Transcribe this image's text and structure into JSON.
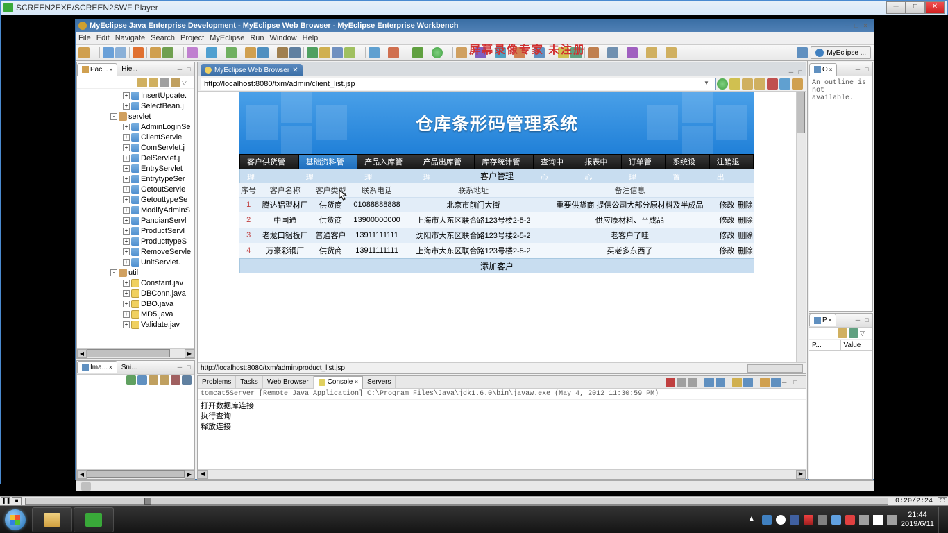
{
  "outer_window": {
    "title": "SCREEN2EXE/SCREEN2SWF Player"
  },
  "overlay": "屏幕录像专家  未注册",
  "ide": {
    "title": "MyEclipse Java Enterprise Development - MyEclipse Web Browser - MyEclipse Enterprise Workbench",
    "menus": [
      "File",
      "Edit",
      "Navigate",
      "Search",
      "Project",
      "MyEclipse",
      "Run",
      "Window",
      "Help"
    ],
    "perspective_pill": "MyEclipse ..."
  },
  "package_explorer": {
    "tabs": [
      "Pac...",
      "Hie..."
    ],
    "active": 0,
    "items": [
      {
        "type": "file",
        "exp": "+",
        "label": "InsertUpdate."
      },
      {
        "type": "file",
        "exp": "+",
        "label": "SelectBean.j"
      },
      {
        "type": "pkg",
        "exp": "-",
        "label": "servlet"
      },
      {
        "type": "file",
        "exp": "+",
        "label": "AdminLoginSe"
      },
      {
        "type": "file",
        "exp": "+",
        "label": "ClientServle"
      },
      {
        "type": "file",
        "exp": "+",
        "label": "ComServlet.j"
      },
      {
        "type": "file",
        "exp": "+",
        "label": "DelServlet.j"
      },
      {
        "type": "file",
        "exp": "+",
        "label": "EntryServlet"
      },
      {
        "type": "file",
        "exp": "+",
        "label": "EntrytypeSer"
      },
      {
        "type": "file",
        "exp": "+",
        "label": "GetoutServle"
      },
      {
        "type": "file",
        "exp": "+",
        "label": "GetouttypeSe"
      },
      {
        "type": "file",
        "exp": "+",
        "label": "ModifyAdminS"
      },
      {
        "type": "file",
        "exp": "+",
        "label": "PandianServl"
      },
      {
        "type": "file",
        "exp": "+",
        "label": "ProductServl"
      },
      {
        "type": "file",
        "exp": "+",
        "label": "ProducttypeS"
      },
      {
        "type": "file",
        "exp": "+",
        "label": "RemoveServle"
      },
      {
        "type": "file",
        "exp": "+",
        "label": "UnitServlet."
      },
      {
        "type": "pkg",
        "exp": "-",
        "label": "util"
      },
      {
        "type": "file",
        "exp": "+",
        "label": "Constant.jav",
        "icon": "java"
      },
      {
        "type": "file",
        "exp": "+",
        "label": "DBConn.java",
        "icon": "java"
      },
      {
        "type": "file",
        "exp": "+",
        "label": "DBO.java",
        "icon": "java"
      },
      {
        "type": "file",
        "exp": "+",
        "label": "MD5.java",
        "icon": "java"
      },
      {
        "type": "file",
        "exp": "+",
        "label": "Validate.jav",
        "icon": "java"
      }
    ]
  },
  "image_pane": {
    "tabs": [
      "Ima...",
      "Sni..."
    ],
    "active": 0
  },
  "editor": {
    "tab_title": "MyEclipse Web Browser",
    "url": "http://localhost:8080/txm/admin/client_list.jsp",
    "status_url": "http://localhost:8080/txm/admin/product_list.jsp"
  },
  "webapp": {
    "banner_title": "仓库条形码管理系统",
    "nav": [
      "客户供货管理",
      "基础资料管理",
      "产品入库管理",
      "产品出库管理",
      "库存统计管理",
      "查询中心",
      "报表中心",
      "订单管理",
      "系统设置",
      "注销退出"
    ],
    "nav_active": 1,
    "section_title": "客户管理",
    "columns": [
      "序号",
      "客户名称",
      "客户类型",
      "联系电话",
      "联系地址",
      "备注信息",
      "",
      ""
    ],
    "rows": [
      {
        "idx": "1",
        "name": "腾达铝型材厂",
        "type": "供货商",
        "phone": "01088888888",
        "addr": "北京市前门大街",
        "note": "重要供货商 提供公司大部分原材料及半成品",
        "edit": "修改",
        "del": "删除"
      },
      {
        "idx": "2",
        "name": "中国通",
        "type": "供货商",
        "phone": "13900000000",
        "addr": "上海市大东区联合路123号楼2-5-2",
        "note": "供应原材料、半成品",
        "edit": "修改",
        "del": "删除"
      },
      {
        "idx": "3",
        "name": "老龙口铝板厂",
        "type": "普通客户",
        "phone": "13911111111",
        "addr": "沈阳市大东区联合路123号楼2-5-2",
        "note": "老客户了哇",
        "edit": "修改",
        "del": "删除"
      },
      {
        "idx": "4",
        "name": "万豪彩钢厂",
        "type": "供货商",
        "phone": "13911111111",
        "addr": "上海市大东区联合路123号楼2-5-2",
        "note": "买老多东西了",
        "edit": "修改",
        "del": "删除"
      }
    ],
    "add_label": "添加客户"
  },
  "console": {
    "tabs": [
      "Problems",
      "Tasks",
      "Web Browser",
      "Console",
      "Servers"
    ],
    "active": 3,
    "close_x": "×",
    "header": "tomcat5Server [Remote Java Application] C:\\Program Files\\Java\\jdk1.6.0\\bin\\javaw.exe (May 4, 2012 11:30:59 PM)",
    "lines": [
      "打开数据库连接",
      "执行查询",
      "释放连接"
    ]
  },
  "outline": {
    "tab": "O",
    "close_x": "×",
    "msg": "An outline is not available."
  },
  "properties": {
    "tab": "P",
    "close_x": "×",
    "cols": [
      "P...",
      "Value"
    ]
  },
  "player": {
    "time": "0:20/2:24"
  },
  "clock": {
    "time": "21:44",
    "date": "2019/6/11"
  }
}
